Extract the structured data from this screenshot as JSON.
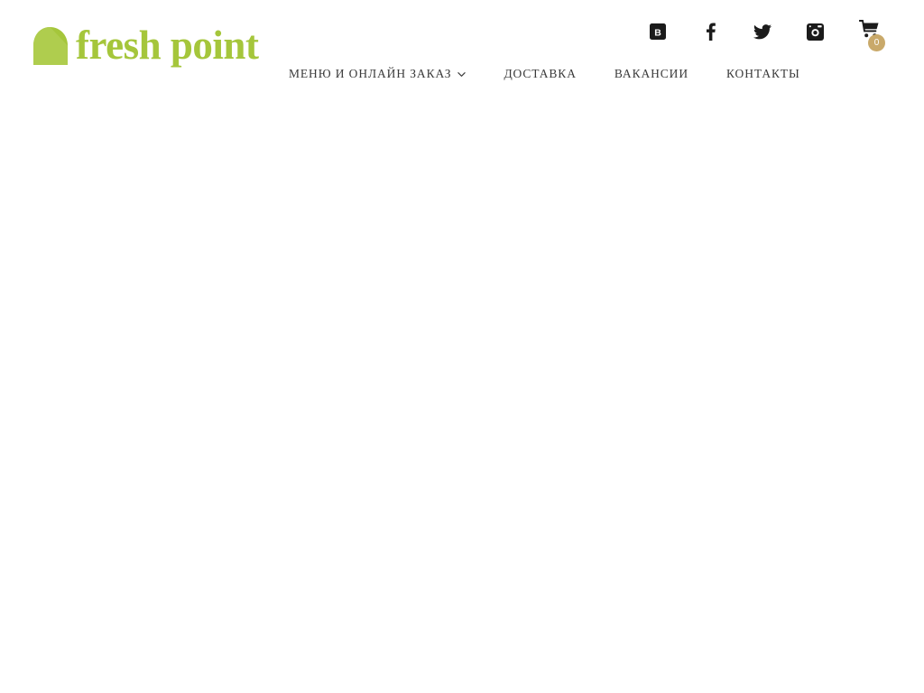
{
  "site": {
    "brand_color": "#A5C63B",
    "nav_text_color": "#3a3a3a",
    "badge_color": "#c9a96a",
    "background_color": "#ffffff"
  },
  "header": {
    "logo": {
      "text": "fresh point",
      "icon": "leaf-icon"
    },
    "social": [
      {
        "name": "vk-icon",
        "label": "ВКонтакте"
      },
      {
        "name": "facebook-icon",
        "label": "Facebook"
      },
      {
        "name": "twitter-icon",
        "label": "Twitter"
      },
      {
        "name": "instagram-icon",
        "label": "Instagram"
      }
    ],
    "cart": {
      "icon": "shopping-cart-icon",
      "count": "0"
    },
    "nav": [
      {
        "label": "МЕНЮ И ОНЛАЙН ЗАКАЗ",
        "has_submenu": true
      },
      {
        "label": "ДОСТАВКА",
        "has_submenu": false
      },
      {
        "label": "ВАКАНСИИ",
        "has_submenu": false
      },
      {
        "label": "КОНТАКТЫ",
        "has_submenu": false
      }
    ]
  },
  "main": {
    "content": ""
  }
}
